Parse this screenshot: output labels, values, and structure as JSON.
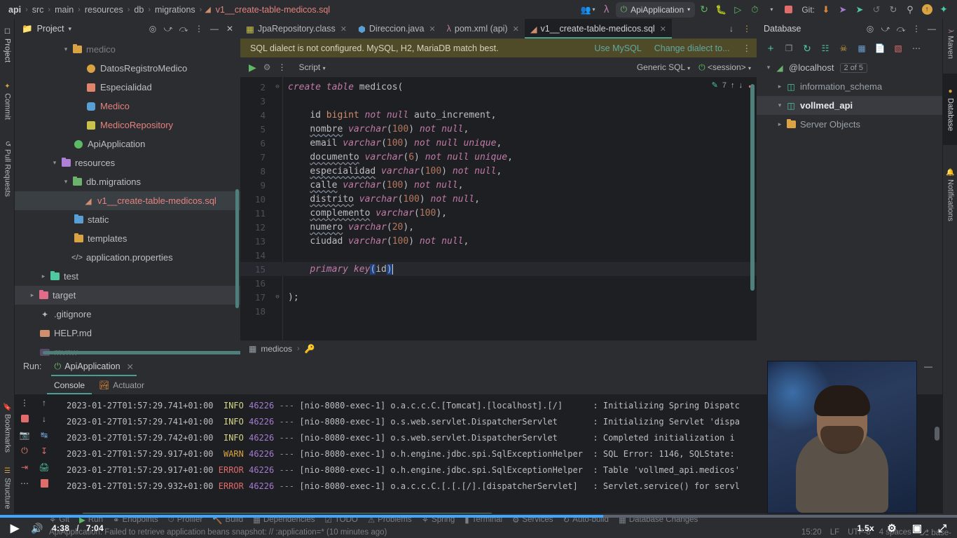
{
  "breadcrumb": {
    "items": [
      "api",
      "src",
      "main",
      "resources",
      "db",
      "migrations"
    ],
    "file": "v1__create-table-medicos.sql"
  },
  "toolbar": {
    "run_config": "ApiApplication",
    "git_label": "Git:",
    "icons": {
      "users": "\u0000",
      "search": "search-icon"
    }
  },
  "left_stripe": {
    "tabs": [
      "Project",
      "Commit",
      "Pull Requests",
      "Bookmarks",
      "Structure"
    ]
  },
  "right_stripe": {
    "tabs": [
      "Maven",
      "Database",
      "Notifications"
    ]
  },
  "project_panel": {
    "title": "Project",
    "tree": [
      {
        "label": "medico",
        "indent": 3,
        "arrow": "∨",
        "icon": "folder-orange",
        "color": "gray"
      },
      {
        "label": "DatosRegistroMedico",
        "indent": 4,
        "arrow": "",
        "icon": "record-yellow",
        "color": "gray"
      },
      {
        "label": "Especialidad",
        "indent": 4,
        "arrow": "",
        "icon": "enum-salmon",
        "color": "gray"
      },
      {
        "label": "Medico",
        "indent": 4,
        "arrow": "",
        "icon": "class-blue",
        "color": "red"
      },
      {
        "label": "MedicoRepository",
        "indent": 4,
        "arrow": "",
        "icon": "interface-yellow",
        "color": "red"
      },
      {
        "label": "ApiApplication",
        "indent": 3,
        "arrow": "",
        "icon": "spring-green",
        "color": "gray"
      },
      {
        "label": "resources",
        "indent": 2,
        "arrow": "∨",
        "icon": "folder-purple",
        "color": "gray"
      },
      {
        "label": "db.migrations",
        "indent": 3,
        "arrow": "∨",
        "icon": "folder-green",
        "color": "gray"
      },
      {
        "label": "v1__create-table-medicos.sql",
        "indent": 4,
        "arrow": "",
        "icon": "sql-file",
        "color": "red",
        "selected": true
      },
      {
        "label": "static",
        "indent": 3,
        "arrow": "",
        "icon": "folder-blue",
        "color": "gray"
      },
      {
        "label": "templates",
        "indent": 3,
        "arrow": "",
        "icon": "folder-orange",
        "color": "gray"
      },
      {
        "label": "application.properties",
        "indent": 3,
        "arrow": "",
        "icon": "code-file",
        "color": "gray"
      },
      {
        "label": "test",
        "indent": 2,
        "arrow": "›",
        "icon": "folder-teal",
        "color": "gray"
      },
      {
        "label": "target",
        "indent": 1,
        "arrow": "›",
        "icon": "folder-pink",
        "color": "gray",
        "selected2": true
      },
      {
        "label": ".gitignore",
        "indent": 2,
        "arrow": "",
        "icon": "git-file",
        "color": "gray"
      },
      {
        "label": "HELP.md",
        "indent": 2,
        "arrow": "",
        "icon": "md-file",
        "color": "gray"
      },
      {
        "label": "mvnw",
        "indent": 2,
        "arrow": "",
        "icon": "script-file",
        "color": "gray"
      }
    ]
  },
  "editor": {
    "tabs": [
      {
        "label": "JpaRepository.class",
        "icon": "interface-icon",
        "active": false
      },
      {
        "label": "Direccion.java",
        "icon": "class-icon",
        "active": false
      },
      {
        "label": "pom.xml (api)",
        "icon": "maven-icon",
        "active": false
      },
      {
        "label": "v1__create-table-medicos.sql",
        "icon": "sql-icon",
        "active": true
      }
    ],
    "notification": {
      "message": "SQL dialect is not configured. MySQL, H2, MariaDB match best.",
      "action_primary": "Use MySQL",
      "action_secondary": "Change dialect to..."
    },
    "sql_toolbar": {
      "script_label": "Script",
      "dialect": "Generic SQL",
      "session": "<session>"
    },
    "inspection_count": "7",
    "breadcrumb": "medicos",
    "code": [
      {
        "n": "2",
        "fold": "⊖",
        "indent": 0,
        "tokens": [
          [
            "kw",
            "create table "
          ],
          [
            "tbl",
            "medicos"
          ],
          [
            "pn",
            "("
          ]
        ]
      },
      {
        "n": "3",
        "fold": "",
        "indent": 0,
        "tokens": []
      },
      {
        "n": "4",
        "fold": "",
        "indent": 4,
        "tokens": [
          [
            "id",
            "id "
          ],
          [
            "kwt",
            "bigint "
          ],
          [
            "kw",
            "not null "
          ],
          [
            "id",
            "auto_increment,"
          ]
        ]
      },
      {
        "n": "5",
        "fold": "",
        "indent": 4,
        "tokens": [
          [
            "sqg",
            "nombre"
          ],
          [
            "typ",
            " varchar"
          ],
          [
            "pn",
            "("
          ],
          [
            "num",
            "100"
          ],
          [
            "pn",
            ")"
          ],
          [
            "kw",
            " not null"
          ],
          [
            "pn",
            ","
          ]
        ]
      },
      {
        "n": "6",
        "fold": "",
        "indent": 4,
        "tokens": [
          [
            "id",
            "email"
          ],
          [
            "typ",
            " varchar"
          ],
          [
            "pn",
            "("
          ],
          [
            "num",
            "100"
          ],
          [
            "pn",
            ")"
          ],
          [
            "kw",
            " not null unique"
          ],
          [
            "pn",
            ","
          ]
        ]
      },
      {
        "n": "7",
        "fold": "",
        "indent": 4,
        "tokens": [
          [
            "sqg",
            "documento"
          ],
          [
            "typ",
            " varchar"
          ],
          [
            "pn",
            "("
          ],
          [
            "num",
            "6"
          ],
          [
            "pn",
            ")"
          ],
          [
            "kw",
            " not null unique"
          ],
          [
            "pn",
            ","
          ]
        ]
      },
      {
        "n": "8",
        "fold": "",
        "indent": 4,
        "tokens": [
          [
            "sqg",
            "especialidad"
          ],
          [
            "typ",
            " varchar"
          ],
          [
            "pn",
            "("
          ],
          [
            "num",
            "100"
          ],
          [
            "pn",
            ")"
          ],
          [
            "kw",
            " not null"
          ],
          [
            "pn",
            ","
          ]
        ]
      },
      {
        "n": "9",
        "fold": "",
        "indent": 4,
        "tokens": [
          [
            "sqg",
            "calle"
          ],
          [
            "typ",
            " varchar"
          ],
          [
            "pn",
            "("
          ],
          [
            "num",
            "100"
          ],
          [
            "pn",
            ")"
          ],
          [
            "kw",
            " not null"
          ],
          [
            "pn",
            ","
          ]
        ]
      },
      {
        "n": "10",
        "fold": "",
        "indent": 4,
        "tokens": [
          [
            "sqg",
            "distrito"
          ],
          [
            "typ",
            " varchar"
          ],
          [
            "pn",
            "("
          ],
          [
            "num",
            "100"
          ],
          [
            "pn",
            ")"
          ],
          [
            "kw",
            " not null"
          ],
          [
            "pn",
            ","
          ]
        ]
      },
      {
        "n": "11",
        "fold": "",
        "indent": 4,
        "tokens": [
          [
            "sqg",
            "complemento"
          ],
          [
            "typ",
            " varchar"
          ],
          [
            "pn",
            "("
          ],
          [
            "num",
            "100"
          ],
          [
            "pn",
            "),"
          ]
        ]
      },
      {
        "n": "12",
        "fold": "",
        "indent": 4,
        "tokens": [
          [
            "sqg",
            "numero"
          ],
          [
            "typ",
            " varchar"
          ],
          [
            "pn",
            "("
          ],
          [
            "num",
            "20"
          ],
          [
            "pn",
            "),"
          ]
        ]
      },
      {
        "n": "13",
        "fold": "",
        "indent": 4,
        "tokens": [
          [
            "id",
            "ciudad"
          ],
          [
            "typ",
            " varchar"
          ],
          [
            "pn",
            "("
          ],
          [
            "num",
            "100"
          ],
          [
            "pn",
            ")"
          ],
          [
            "kw",
            " not null"
          ],
          [
            "pn",
            ","
          ]
        ]
      },
      {
        "n": "14",
        "fold": "",
        "indent": 4,
        "tokens": []
      },
      {
        "n": "15",
        "fold": "",
        "indent": 4,
        "highlight": true,
        "tokens": [
          [
            "kw",
            "primary key"
          ],
          [
            "selbg",
            "("
          ],
          [
            "id",
            "id"
          ],
          [
            "selbg",
            ")"
          ],
          [
            "caret",
            ""
          ]
        ]
      },
      {
        "n": "16",
        "fold": "",
        "indent": 0,
        "tokens": []
      },
      {
        "n": "17",
        "fold": "⊖",
        "indent": 0,
        "tokens": [
          [
            "pn",
            ");"
          ]
        ]
      },
      {
        "n": "18",
        "fold": "",
        "indent": 0,
        "tokens": []
      }
    ]
  },
  "database_panel": {
    "title": "Database",
    "tree": [
      {
        "label": "@localhost",
        "badge": "2 of 5",
        "indent": 0,
        "arrow": "∨",
        "icon": "datasource-icon"
      },
      {
        "label": "information_schema",
        "indent": 1,
        "arrow": "›",
        "icon": "schema-icon"
      },
      {
        "label": "vollmed_api",
        "indent": 1,
        "arrow": "∨",
        "icon": "schema-icon",
        "selected": true
      },
      {
        "label": "Server Objects",
        "indent": 1,
        "arrow": "›",
        "icon": "folder-orange"
      }
    ]
  },
  "run_panel": {
    "run_label": "Run:",
    "config_name": "ApiApplication",
    "tabs": [
      {
        "label": "Console",
        "active": true
      },
      {
        "label": "Actuator",
        "active": false
      }
    ],
    "log": [
      {
        "ts": "2023-01-27T01:57:29.741+01:00",
        "level": "INFO",
        "pid": "46226",
        "thread": "[nio-8080-exec-1]",
        "cls": "o.a.c.c.C.[Tomcat].[localhost].[/]",
        "msg": ": Initializing Spring Dispatc"
      },
      {
        "ts": "2023-01-27T01:57:29.741+01:00",
        "level": "INFO",
        "pid": "46226",
        "thread": "[nio-8080-exec-1]",
        "cls": "o.s.web.servlet.DispatcherServlet",
        "msg": ": Initializing Servlet 'dispa"
      },
      {
        "ts": "2023-01-27T01:57:29.742+01:00",
        "level": "INFO",
        "pid": "46226",
        "thread": "[nio-8080-exec-1]",
        "cls": "o.s.web.servlet.DispatcherServlet",
        "msg": ": Completed initialization i"
      },
      {
        "ts": "2023-01-27T01:57:29.917+01:00",
        "level": "WARN",
        "pid": "46226",
        "thread": "[nio-8080-exec-1]",
        "cls": "o.h.engine.jdbc.spi.SqlExceptionHelper",
        "msg": ": SQL Error: 1146, SQLState:"
      },
      {
        "ts": "2023-01-27T01:57:29.917+01:00",
        "level": "ERROR",
        "pid": "46226",
        "thread": "[nio-8080-exec-1]",
        "cls": "o.h.engine.jdbc.spi.SqlExceptionHelper",
        "msg": ": Table 'vollmed_api.medicos'"
      },
      {
        "ts": "2023-01-27T01:57:29.932+01:00",
        "level": "ERROR",
        "pid": "46226",
        "thread": "[nio-8080-exec-1]",
        "cls": "o.a.c.c.C.[.[.[/].[dispatcherServlet]",
        "msg": ": Servlet.service() for servl"
      }
    ]
  },
  "bottom_bar": {
    "windows": [
      "Git",
      "Run",
      "Endpoints",
      "Profiler",
      "Build",
      "Dependencies",
      "TODO",
      "Problems",
      "Spring",
      "Terminal",
      "Services",
      "Auto-build",
      "Database Changes"
    ]
  },
  "status_bar": {
    "message": "ApiApplication: Failed to retrieve application beans snapshot: // :application=* (10 minutes ago)",
    "caret": "15:20",
    "line_sep": "LF",
    "encoding": "UTF-8",
    "indent": "4 spaces",
    "branch": "base-"
  },
  "video_player": {
    "current_time": "4:38",
    "separator": "/",
    "total_time": "7:04",
    "speed": "1.5x",
    "progress_percent": 63
  },
  "colors": {
    "accent": "#4a9e93",
    "error": "#e06c6c",
    "warn": "#d9a343",
    "info": "#d7d78a",
    "link": "#62a8a0",
    "progress": "#3ea6ff"
  }
}
